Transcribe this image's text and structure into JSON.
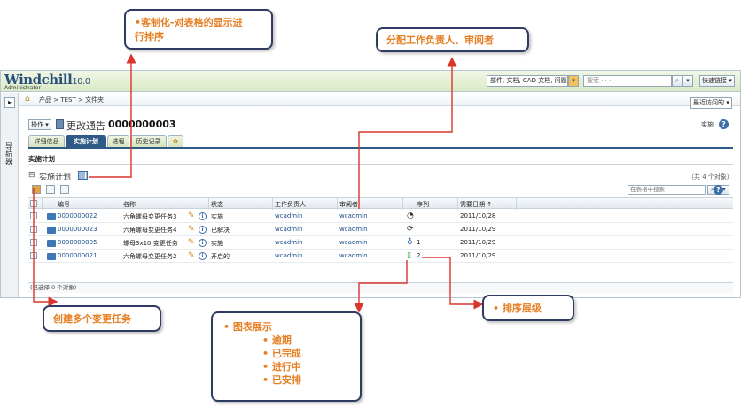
{
  "app": {
    "logo": "Windchill",
    "version": "10.0",
    "role": "Administrator",
    "search_scope": "部件, 文档, CAD 文档, 问题报",
    "search_placeholder": "搜索 · · ·",
    "quick_links": "快速链接",
    "nav_panel": "导航器",
    "home_icon": "⌂",
    "breadcrumb": "产品 > TEST > 文件夹",
    "recent": "最近访问的",
    "actions_menu": "操作",
    "title_prefix": "更改通告 -",
    "title_number": "0000000003",
    "state_label": "实施",
    "help": "?",
    "tabs": [
      "详细信息",
      "实施计划",
      "进程",
      "历史记录",
      "✿"
    ],
    "section_title": "实施计划",
    "table_title": "实施计划",
    "table_count": "（共 4 个对象）",
    "table_search_placeholder": "在表格中搜索",
    "columns": [
      "编号",
      "名称",
      "状态",
      "工作负责人",
      "审阅者",
      "序列",
      "需要日期 ↑"
    ],
    "rows": [
      {
        "number": "0000000022",
        "name": "六角螺母变更任务3",
        "state": "实施",
        "assignee": "wcadmin",
        "reviewer": "wcadmin",
        "seq_icon": "◔",
        "seq": "",
        "date": "2011/10/28"
      },
      {
        "number": "0000000023",
        "name": "六角螺母变更任务4",
        "state": "已解决",
        "assignee": "wcadmin",
        "reviewer": "wcadmin",
        "seq_icon": "⟳",
        "seq": "",
        "date": "2011/10/29"
      },
      {
        "number": "0000000005",
        "name": "螺母3x10 变更任务",
        "state": "实施",
        "assignee": "wcadmin",
        "reviewer": "wcadmin",
        "seq_icon": "♁",
        "seq": "1",
        "date": "2011/10/29"
      },
      {
        "number": "0000000021",
        "name": "六角螺母变更任务2",
        "state": "开启的",
        "assignee": "wcadmin",
        "reviewer": "wcadmin",
        "seq_icon": "▯",
        "seq": "2",
        "date": "2011/10/29"
      }
    ],
    "selected_footer": "(已选择 0 个对象)"
  },
  "callouts": {
    "customize": [
      "•客制化-对表格的显示进",
      "行排序"
    ],
    "assign": "分配工作负责人、审阅者",
    "create_tasks": "创建多个变更任务",
    "sort_level": "• 排序层级",
    "chart": {
      "heading": "• 图表展示",
      "items": [
        "• 逾期",
        "• 已完成",
        "• 进行中",
        "• 已安排"
      ]
    }
  },
  "colors": {
    "callout_text": "#e67e22",
    "callout_border": "#2e3b63",
    "arrow": "#d9362b",
    "tab_active": "#2f5a86",
    "link": "#1a4d8f"
  }
}
